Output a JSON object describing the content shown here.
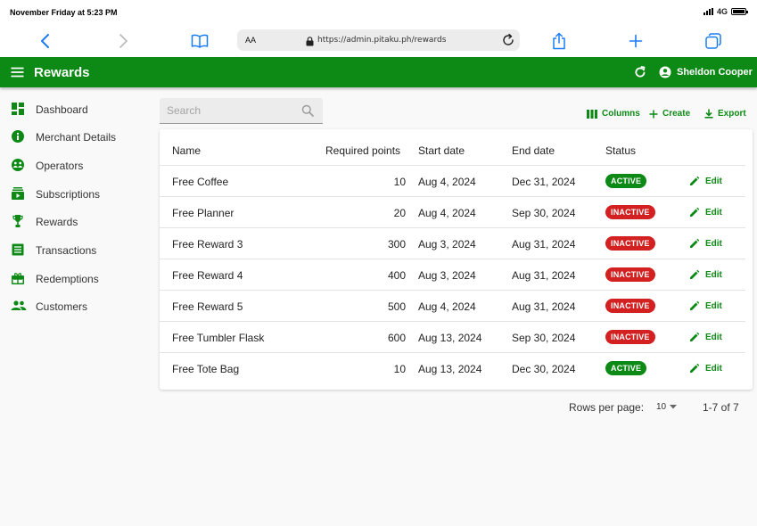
{
  "status_bar": {
    "time": "November Friday at 5:23 PM",
    "network": "4G"
  },
  "browser": {
    "aa_label": "AA",
    "url": "https://admin.pitaku.ph/rewards"
  },
  "appbar": {
    "title": "Rewards",
    "user_name": "Sheldon Cooper"
  },
  "sidebar": {
    "items": [
      {
        "label": "Dashboard",
        "icon": "dashboard-icon"
      },
      {
        "label": "Merchant Details",
        "icon": "info-icon"
      },
      {
        "label": "Operators",
        "icon": "operators-icon"
      },
      {
        "label": "Subscriptions",
        "icon": "subscriptions-icon"
      },
      {
        "label": "Rewards",
        "icon": "trophy-icon"
      },
      {
        "label": "Transactions",
        "icon": "list-icon"
      },
      {
        "label": "Redemptions",
        "icon": "gift-icon"
      },
      {
        "label": "Customers",
        "icon": "people-icon"
      }
    ]
  },
  "toolbar": {
    "search_placeholder": "Search",
    "columns_label": "Columns",
    "create_label": "Create",
    "export_label": "Export"
  },
  "table": {
    "columns": [
      "Name",
      "Required points",
      "Start date",
      "End date",
      "Status"
    ],
    "edit_label": "Edit",
    "rows": [
      {
        "name": "Free Coffee",
        "points": "10",
        "start": "Aug 4, 2024",
        "end": "Dec 31, 2024",
        "status": "ACTIVE"
      },
      {
        "name": "Free Planner",
        "points": "20",
        "start": "Aug 4, 2024",
        "end": "Sep 30, 2024",
        "status": "INACTIVE"
      },
      {
        "name": "Free Reward 3",
        "points": "300",
        "start": "Aug 3, 2024",
        "end": "Aug 31, 2024",
        "status": "INACTIVE"
      },
      {
        "name": "Free Reward 4",
        "points": "400",
        "start": "Aug 3, 2024",
        "end": "Aug 31, 2024",
        "status": "INACTIVE"
      },
      {
        "name": "Free Reward 5",
        "points": "500",
        "start": "Aug 4, 2024",
        "end": "Aug 31, 2024",
        "status": "INACTIVE"
      },
      {
        "name": "Free Tumbler Flask",
        "points": "600",
        "start": "Aug 13, 2024",
        "end": "Sep 30, 2024",
        "status": "INACTIVE"
      },
      {
        "name": "Free Tote Bag",
        "points": "10",
        "start": "Aug 13, 2024",
        "end": "Dec 30, 2024",
        "status": "ACTIVE"
      }
    ]
  },
  "pagination": {
    "rows_per_page_label": "Rows per page:",
    "rows_per_page_value": "10",
    "range": "1-7 of 7"
  },
  "colors": {
    "brand": "#0d8a15",
    "active": "#0d8a15",
    "inactive": "#d32020",
    "ios_blue": "#1a7cf5"
  }
}
